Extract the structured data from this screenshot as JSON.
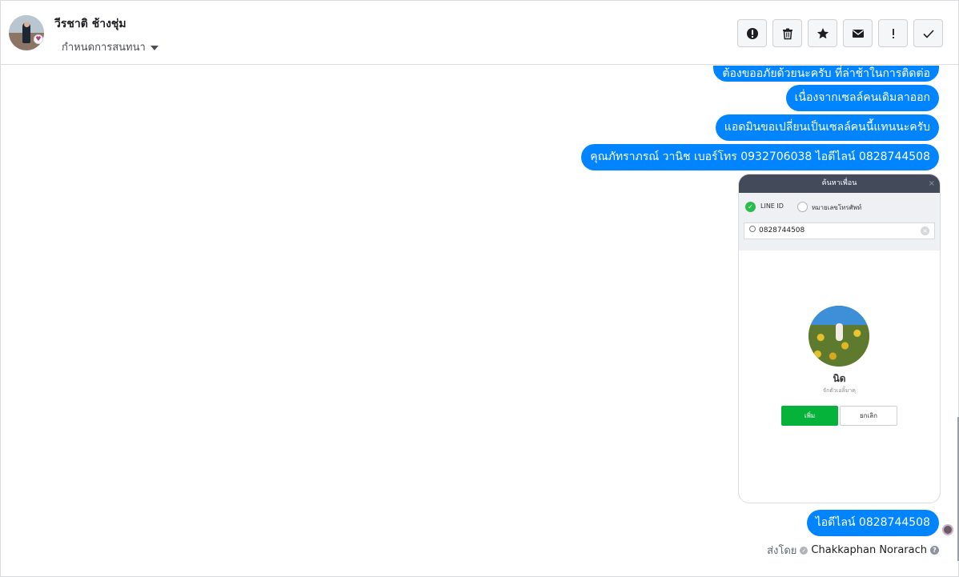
{
  "header": {
    "contact_name": "วีรชาติ ช้างชุ่ม",
    "conversation_settings": "กำหนดการสนทนา",
    "actions": [
      {
        "name": "spam-button",
        "icon": "alert-circle-icon"
      },
      {
        "name": "delete-button",
        "icon": "trash-icon"
      },
      {
        "name": "star-button",
        "icon": "star-icon"
      },
      {
        "name": "mark-unread-button",
        "icon": "envelope-icon"
      },
      {
        "name": "follow-up-button",
        "icon": "exclamation-icon"
      },
      {
        "name": "done-button",
        "icon": "check-icon"
      }
    ]
  },
  "messages": [
    "ต้องขออภัยด้วยนะครับ ที่ล่าช้าในการติดต่อ",
    "เนื่องจากเซลล์คนเดิมลาออก",
    "แอดมินขอเปลี่ยนเป็นเซลล์คนนี้แทนนะครับ",
    "คุณภัทราภรณ์  วานิช  เบอร์โทร 0932706038       ไอดีไลน์ 0828744508",
    "ไอดีไลน์ 0828744508"
  ],
  "image_card": {
    "title": "ค้นหาเพื่อน",
    "close": "×",
    "option_line_id": "LINE ID",
    "option_phone": "หมายเลขโทรศัพท์",
    "search_value": "0828744508",
    "clear": "×",
    "friend_name": "นิด",
    "friend_sub": "จักตัวเอลิ้มาคุ",
    "add_label": "เพิ่ม",
    "cancel_label": "ยกเลิก",
    "check": "✓"
  },
  "footer": {
    "sent_by_prefix": "ส่งโดย",
    "sender": "Chakkaphan Norarach",
    "help": "?"
  },
  "colors": {
    "bubble": "#0084ff",
    "line_green": "#06b33a"
  }
}
